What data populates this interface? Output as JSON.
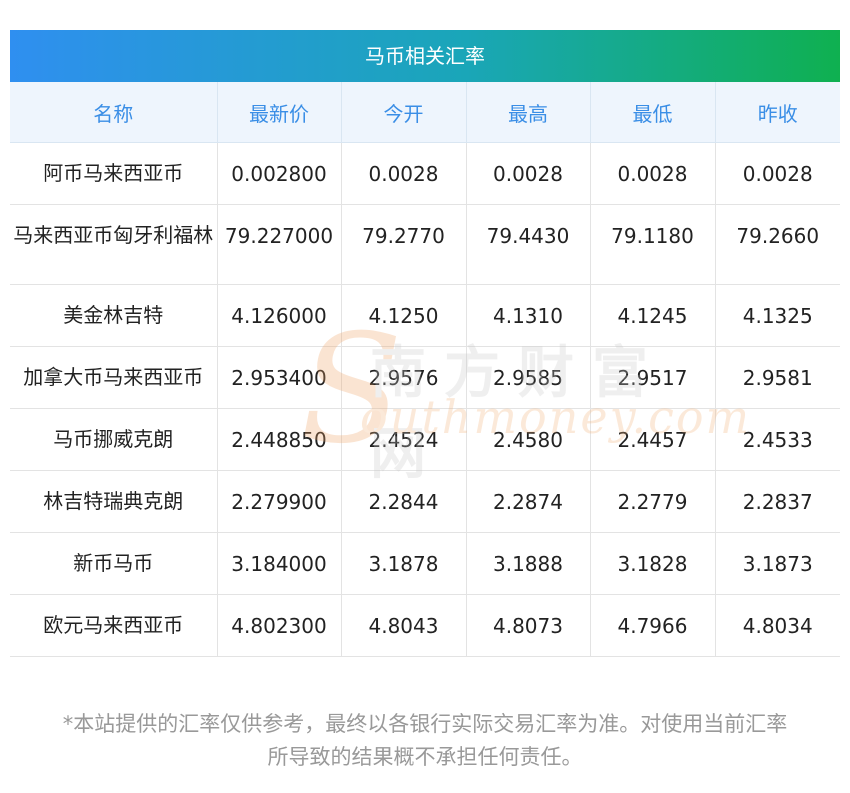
{
  "title": "马币相关汇率",
  "columns": [
    "名称",
    "最新价",
    "今开",
    "最高",
    "最低",
    "昨收"
  ],
  "rows": [
    [
      "阿币马来西亚币",
      "0.002800",
      "0.0028",
      "0.0028",
      "0.0028",
      "0.0028"
    ],
    [
      "马来西亚币匈牙利福林",
      "79.227000",
      "79.2770",
      "79.4430",
      "79.1180",
      "79.2660"
    ],
    [
      "美金林吉特",
      "4.126000",
      "4.1250",
      "4.1310",
      "4.1245",
      "4.1325"
    ],
    [
      "加拿大币马来西亚币",
      "2.953400",
      "2.9576",
      "2.9585",
      "2.9517",
      "2.9581"
    ],
    [
      "马币挪威克朗",
      "2.448850",
      "2.4524",
      "2.4580",
      "2.4457",
      "2.4533"
    ],
    [
      "林吉特瑞典克朗",
      "2.279900",
      "2.2844",
      "2.2874",
      "2.2779",
      "2.2837"
    ],
    [
      "新币马币",
      "3.184000",
      "3.1878",
      "3.1888",
      "3.1828",
      "3.1873"
    ],
    [
      "欧元马来西亚币",
      "4.802300",
      "4.8043",
      "4.8073",
      "4.7966",
      "4.8034"
    ]
  ],
  "watermark": {
    "letter": "S",
    "chinese": "南方财富网",
    "english": "outhmoney.com"
  },
  "disclaimer": {
    "line1": "*本站提供的汇率仅供参考，最终以各银行实际交易汇率为准。对使用当前汇率",
    "line2": "所导致的结果概不承担任何责任。"
  },
  "colors": {
    "banner_start": "#2f8ff0",
    "banner_end": "#0fb050",
    "header_text": "#3a8ee6",
    "header_bg": "#eef5fd",
    "disclaimer_text": "#999999"
  }
}
